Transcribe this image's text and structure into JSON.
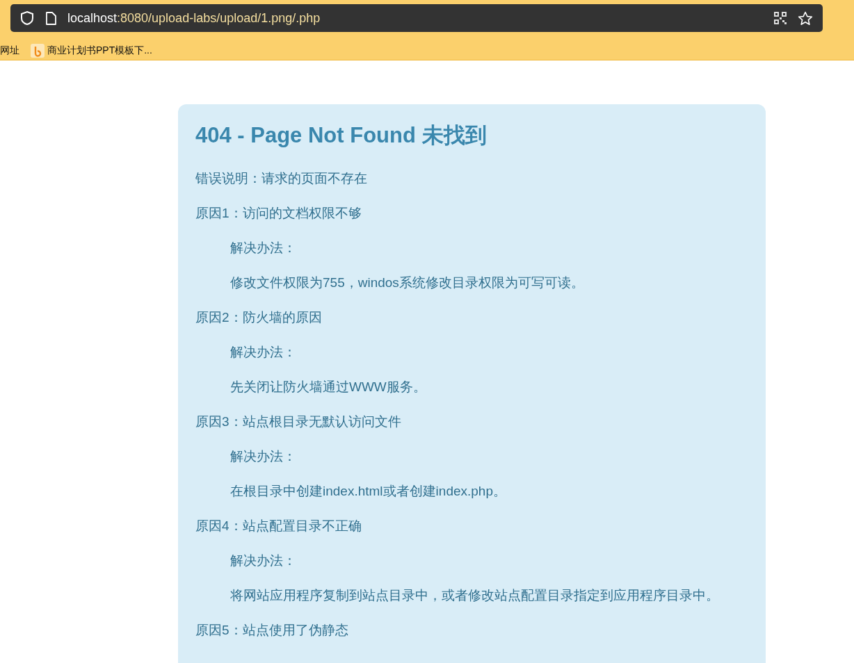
{
  "address_bar": {
    "host": "localhost",
    "path": ":8080/upload-labs/upload/1.png/.php"
  },
  "bookmarks": [
    {
      "label": "网址",
      "kind": "plain"
    },
    {
      "label": "商业计划书PPT模板下...",
      "kind": "favicon"
    }
  ],
  "error_panel": {
    "title": "404 - Page Not Found 未找到",
    "lines": [
      {
        "text": "错误说明：请求的页面不存在",
        "kind": "reason"
      },
      {
        "text": "原因1：访问的文档权限不够",
        "kind": "reason"
      },
      {
        "text": "解决办法：",
        "kind": "solution"
      },
      {
        "text": "修改文件权限为755，windos系统修改目录权限为可写可读。",
        "kind": "solution"
      },
      {
        "text": "原因2：防火墙的原因",
        "kind": "reason"
      },
      {
        "text": "解决办法：",
        "kind": "solution"
      },
      {
        "text": "先关闭让防火墙通过WWW服务。",
        "kind": "solution"
      },
      {
        "text": "原因3：站点根目录无默认访问文件",
        "kind": "reason"
      },
      {
        "text": "解决办法：",
        "kind": "solution"
      },
      {
        "text": "在根目录中创建index.html或者创建index.php。",
        "kind": "solution"
      },
      {
        "text": "原因4：站点配置目录不正确",
        "kind": "reason"
      },
      {
        "text": "解决办法：",
        "kind": "solution"
      },
      {
        "text": "将网站应用程序复制到站点目录中，或者修改站点配置目录指定到应用程序目录中。",
        "kind": "solution"
      },
      {
        "text": "原因5：站点使用了伪静态",
        "kind": "reason"
      }
    ]
  }
}
